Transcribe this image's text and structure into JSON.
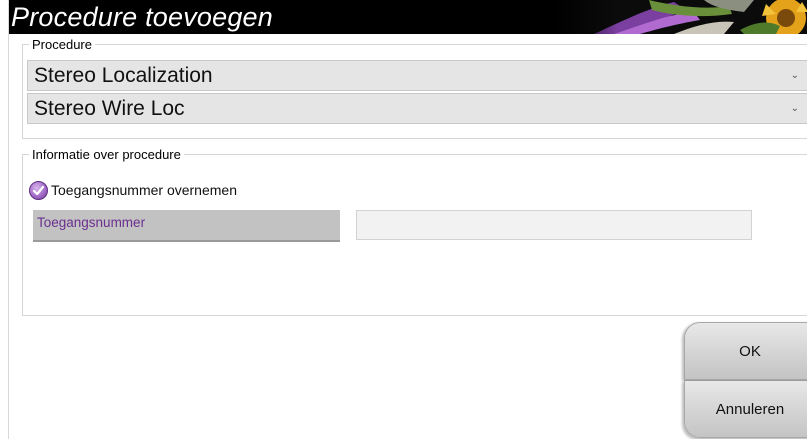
{
  "dialog": {
    "title": "Procedure toevoegen"
  },
  "procedure_group": {
    "legend": "Procedure",
    "procedure_select": {
      "value": "Stereo Localization"
    },
    "subprocedure_select": {
      "value": "Stereo Wire Loc"
    }
  },
  "info_group": {
    "legend": "Informatie over procedure",
    "copy_accession_checkbox": {
      "label": "Toegangsnummer overnemen",
      "checked": true
    },
    "accession_label": "Toegangsnummer",
    "accession_input": {
      "value": ""
    }
  },
  "buttons": {
    "ok": "OK",
    "cancel": "Annuleren"
  },
  "colors": {
    "titlebar": "#000000",
    "accent_purple": "#6b2f8f",
    "checkbox_purple": "#a46cc8"
  },
  "icons": {
    "dropdown": "chevron-down-icon",
    "checkbox": "check-icon"
  }
}
